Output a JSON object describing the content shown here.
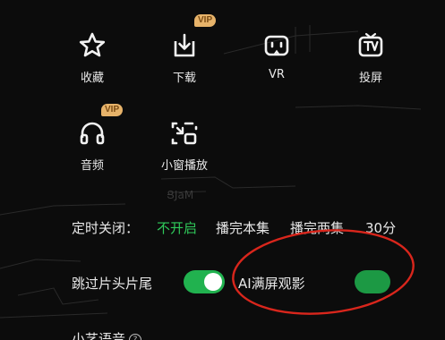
{
  "actions": [
    {
      "label": "收藏",
      "icon": "star-icon"
    },
    {
      "label": "下载",
      "icon": "download-icon",
      "badge": "VIP"
    },
    {
      "label": "VR",
      "icon": "vr-icon"
    },
    {
      "label": "投屏",
      "icon": "tv-cast-icon"
    },
    {
      "label": "音频",
      "icon": "headphones-icon",
      "badge": "VIP"
    },
    {
      "label": "小窗播放",
      "icon": "mini-window-icon"
    }
  ],
  "timer": {
    "label": "定时关闭：",
    "options": [
      "不开启",
      "播完本集",
      "播完两集",
      "30分"
    ],
    "selected": "不开启"
  },
  "switches": {
    "skip_intro_label": "跳过片头片尾",
    "skip_intro_on": true,
    "ai_fullscreen_label": "AI满屏观影",
    "ai_fullscreen_on": true
  },
  "voice": {
    "label": "小艺语音"
  },
  "colors": {
    "accent_green": "#2fca5a",
    "toggle_green": "#21b24f",
    "vip_gold": "#e7b36a",
    "annotation_red": "#d9261c"
  }
}
